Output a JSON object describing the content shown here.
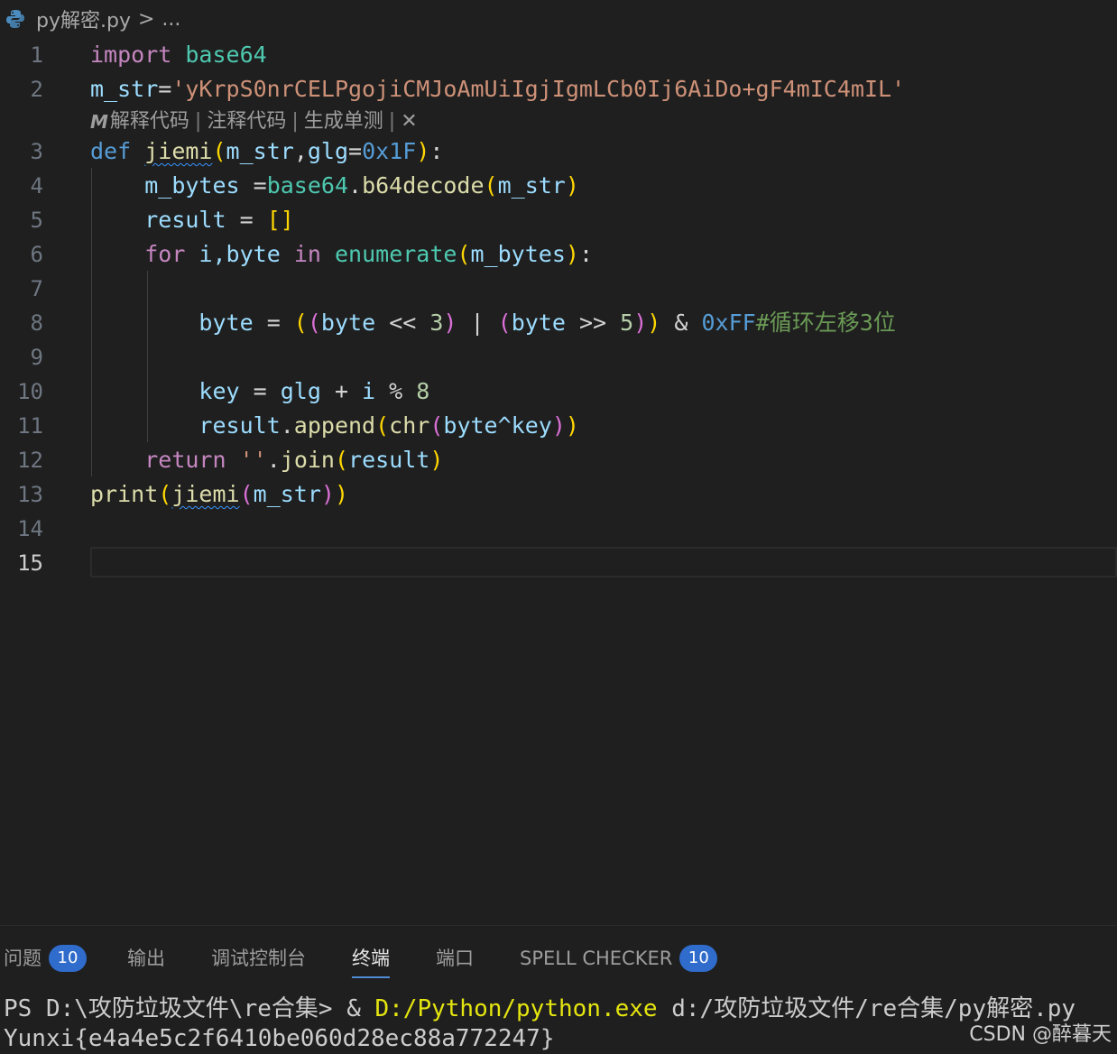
{
  "breadcrumb": {
    "file": "py解密.py",
    "separator": ">",
    "more": "..."
  },
  "codelens": {
    "items": [
      "解释代码",
      "注释代码",
      "生成单测"
    ],
    "separator": "|",
    "close": "✕"
  },
  "editor": {
    "line_numbers": [
      "1",
      "2",
      "3",
      "4",
      "5",
      "6",
      "7",
      "8",
      "9",
      "10",
      "11",
      "12",
      "13",
      "14",
      "15"
    ],
    "active_line": "15",
    "code": {
      "l1_kw": "import",
      "l1_mod": "base64",
      "l2_var": "m_str",
      "l2_op": "=",
      "l2_str": "'yKrpS0nrCELPgojiCMJoAmUiIgjIgmLCb0Ij6AiDo+gF4mIC4mIL'",
      "l3_def": "def",
      "l3_fn": "jiemi",
      "l3_p1": "m_str",
      "l3_comma": ",",
      "l3_p2": "glg",
      "l3_eq": "=",
      "l3_hex": "0x1F",
      "l3_colon": ":",
      "l4_var": "m_bytes",
      "l4_eq": " =",
      "l4_mod": "base64",
      "l4_dot": ".",
      "l4_fn": "b64decode",
      "l4_arg": "m_str",
      "l5_var": "result",
      "l5_eq": " = ",
      "l5_list": "[]",
      "l6_for": "for",
      "l6_vars": "i,byte",
      "l6_in": "in",
      "l6_fn": "enumerate",
      "l6_arg": "m_bytes",
      "l6_colon": ":",
      "l8_var": "byte",
      "l8_eq": " = ",
      "l8_a": "byte",
      "l8_shl": " << ",
      "l8_n3": "3",
      "l8_pipe": " | ",
      "l8_b": "byte",
      "l8_shr": " >> ",
      "l8_n5": "5",
      "l8_amp": " & ",
      "l8_hex": "0xFF",
      "l8_cmt": "#循环左移3位",
      "l10_var": "key",
      "l10_eq": " = ",
      "l10_glg": "glg",
      "l10_plus": " + ",
      "l10_i": "i",
      "l10_mod": " % ",
      "l10_n8": "8",
      "l11_obj": "result",
      "l11_dot": ".",
      "l11_fn": "append",
      "l11_fn2": "chr",
      "l11_arg": "byte^key",
      "l12_ret": "return",
      "l12_str": "''",
      "l12_dot": ".",
      "l12_fn": "join",
      "l12_arg": "result",
      "l13_fn": "print",
      "l13_fn2": "jiemi",
      "l13_arg": "m_str"
    }
  },
  "panel": {
    "tabs": [
      {
        "label": "问题",
        "badge": "10"
      },
      {
        "label": "输出"
      },
      {
        "label": "调试控制台"
      },
      {
        "label": "终端",
        "active": true
      },
      {
        "label": "端口"
      },
      {
        "label": "SPELL CHECKER",
        "badge": "10"
      }
    ],
    "terminal": {
      "prompt": "PS D:\\攻防垃圾文件\\re合集> ",
      "amp": "& ",
      "exe": "D:/Python/python.exe",
      "script": " d:/攻防垃圾文件/re合集/py解密.py",
      "output": "Yunxi{e4a4e5c2f6410be060d28ec88a772247}"
    }
  },
  "watermark": "CSDN @醉暮天"
}
